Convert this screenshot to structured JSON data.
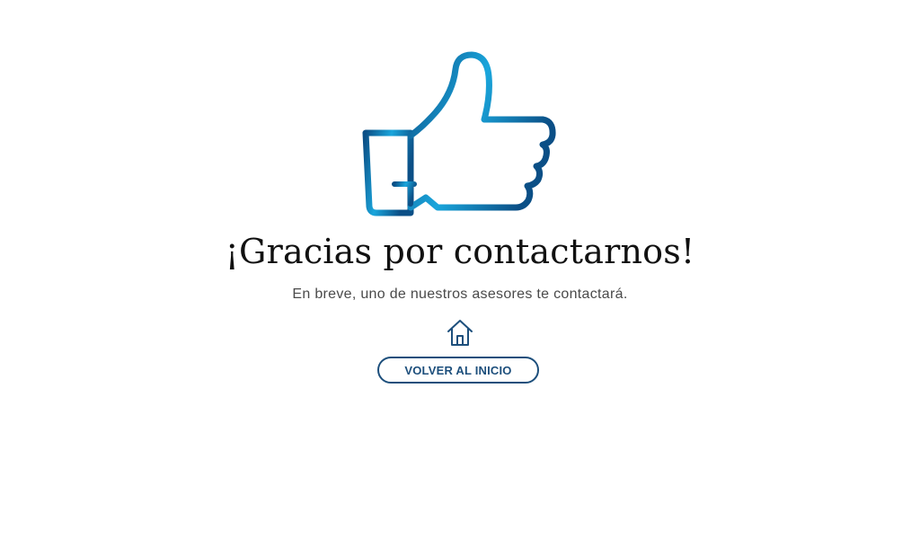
{
  "confirmation": {
    "title": "¡Gracias por contactarnos!",
    "subtitle": "En breve, uno de nuestros asesores te contactará.",
    "button_label": "VOLVER AL INICIO"
  },
  "icons": {
    "hero": "thumbs-up-icon",
    "button": "home-icon"
  },
  "colors": {
    "gradient_dark": "#0b4f86",
    "gradient_light": "#1aa6dc",
    "button_accent": "#1d4f7c",
    "title_text": "#111111",
    "subtitle_text": "#4a4a4a"
  }
}
